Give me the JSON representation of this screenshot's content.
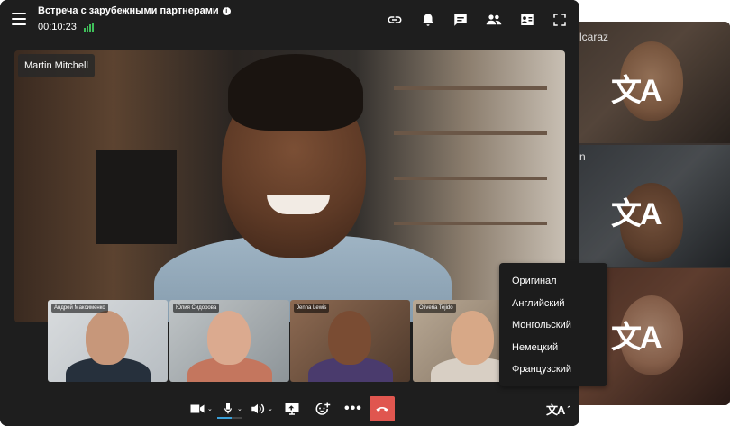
{
  "meeting": {
    "title": "Встреча с зарубежными партнерами",
    "duration": "00:10:23"
  },
  "main_video": {
    "participant": "Martin Mitchell"
  },
  "thumbnails": [
    {
      "name": "Андрей Максименко"
    },
    {
      "name": "Юлия Сидорова"
    },
    {
      "name": "Jenna Lewis"
    },
    {
      "name": "Oliveria Tejido"
    }
  ],
  "side_tiles": [
    {
      "partial_name": "lcaraz"
    },
    {
      "partial_name": "n"
    }
  ],
  "language_menu": {
    "items": [
      "Оригинал",
      "Английский",
      "Монгольский",
      "Немецкий",
      "Французский"
    ]
  },
  "icons": {
    "menu": "hamburger-icon",
    "info": "info-icon",
    "signal": "signal-strength-icon",
    "link": "link-icon",
    "bell": "bell-icon",
    "chat": "chat-icon",
    "participants": "participants-icon",
    "screen_participant": "contact-card-icon",
    "fullscreen": "fullscreen-icon",
    "translate": "translate-icon"
  },
  "colors": {
    "end_call": "#e0564f",
    "signal": "#3fbf5a",
    "mic_level": "#3aa0d9"
  }
}
